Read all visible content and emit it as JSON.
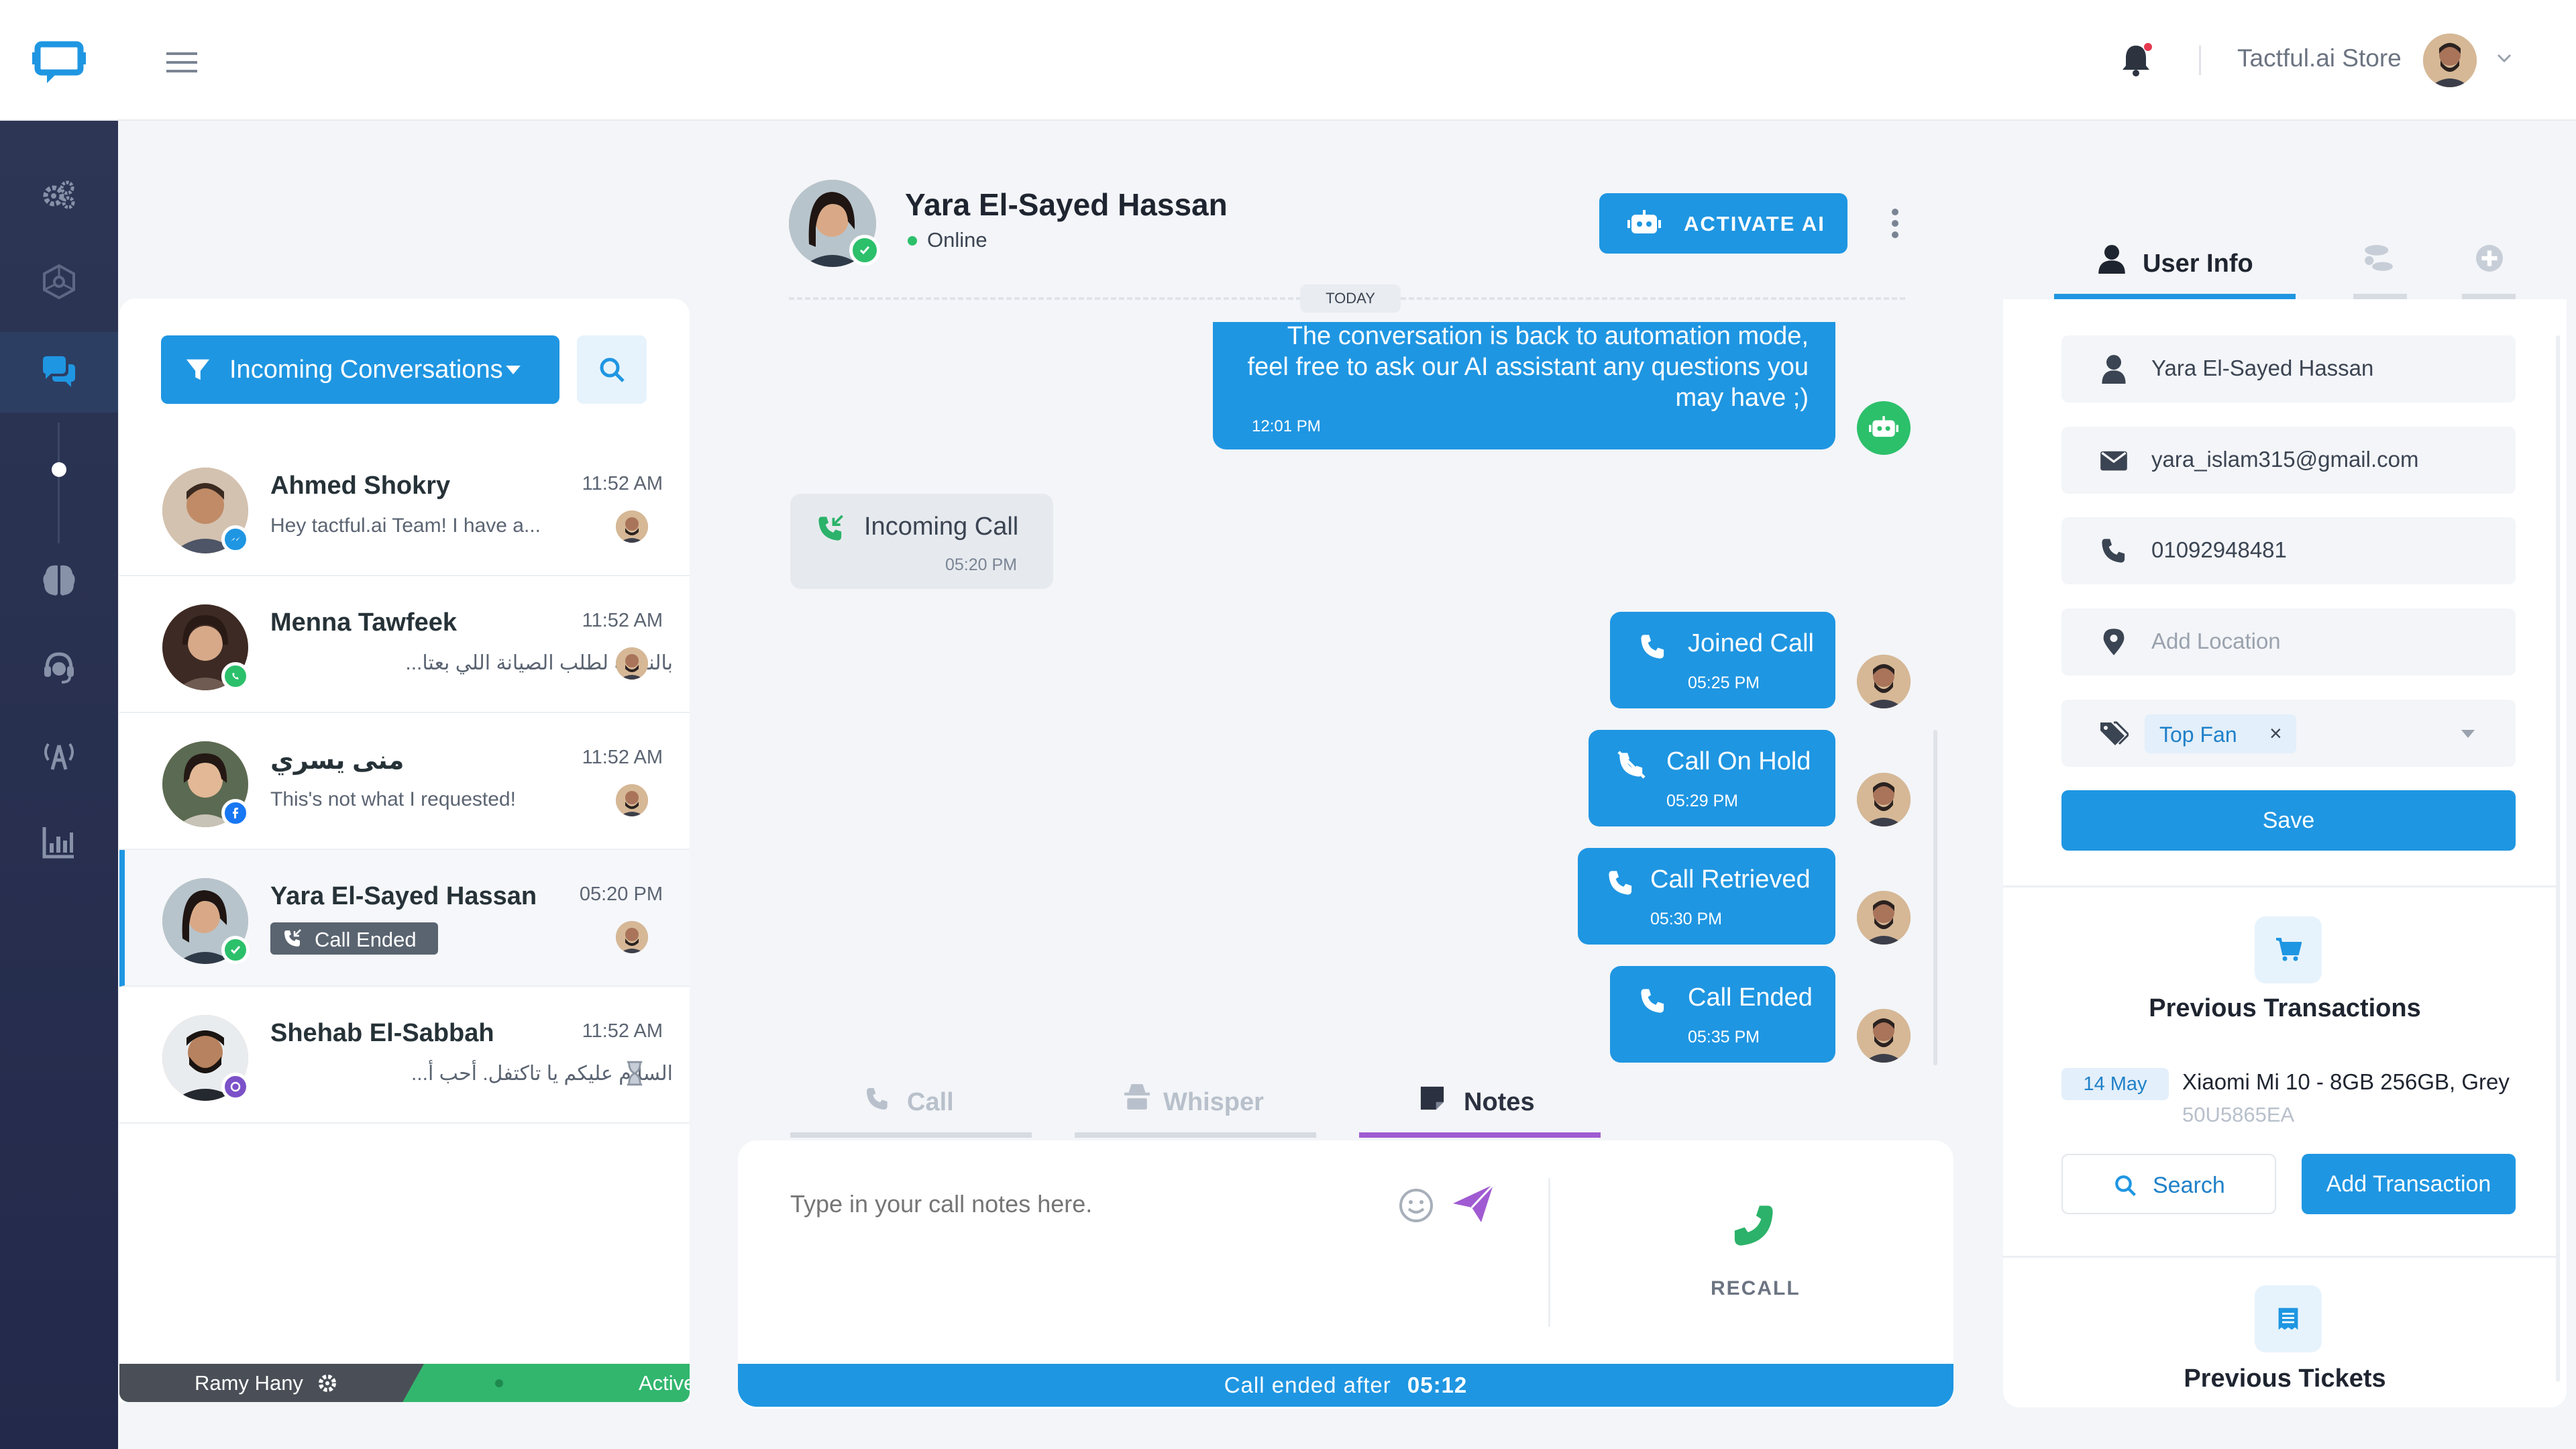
{
  "header": {
    "store_name": "Tactful.ai Store",
    "brand_color": "#1f96e2"
  },
  "sidebar": {
    "items": [
      "settings-icon",
      "network-icon",
      "chat-icon",
      "dot-icon",
      "brain-icon",
      "agent-icon",
      "broadcast-icon",
      "reports-icon"
    ]
  },
  "inbox": {
    "filter_label": "Incoming Conversations",
    "conversations": [
      {
        "name": "Ahmed Shokry",
        "time": "11:52 AM",
        "preview": "Hey tactful.ai Team! I have a...",
        "channel": "messenger"
      },
      {
        "name": "Menna Tawfeek",
        "time": "11:52 AM",
        "preview": "بالنسبة لطلب الصيانة اللي بعتا...",
        "channel": "whatsapp"
      },
      {
        "name": "منى يسري",
        "time": "11:52 AM",
        "preview": "This's not what I requested!",
        "channel": "facebook"
      },
      {
        "name": "Yara El-Sayed Hassan",
        "time": "05:20 PM",
        "preview": "Call Ended",
        "channel": "phone"
      },
      {
        "name": "Shehab El-Sabbah",
        "time": "11:52 AM",
        "preview": "السلام عليكم يا تاكتفل. أحب أ...",
        "channel": "viber"
      }
    ],
    "agent_name": "Ramy Hany",
    "agent_status": "Active"
  },
  "chat": {
    "contact_name": "Yara El-Sayed Hassan",
    "contact_status": "Online",
    "activate_ai_label": "ACTIVATE AI",
    "date_divider": "TODAY",
    "bot_message": {
      "line1": "The conversation is back to automation mode,",
      "line2": "feel free to ask our AI assistant any questions you",
      "line3": "may have ;)",
      "time": "12:01 PM"
    },
    "incoming_call": {
      "label": "Incoming Call",
      "time": "05:20 PM"
    },
    "events": [
      {
        "label": "Joined Call",
        "time": "05:25 PM"
      },
      {
        "label": "Call On Hold",
        "time": "05:29 PM"
      },
      {
        "label": "Call Retrieved",
        "time": "05:30 PM"
      },
      {
        "label": "Call Ended",
        "time": "05:35 PM"
      }
    ],
    "tabs": [
      {
        "label": "Call",
        "active": false
      },
      {
        "label": "Whisper",
        "active": false
      },
      {
        "label": "Notes",
        "active": true
      }
    ],
    "notes_placeholder": "Type in your call notes here.",
    "recall_label": "RECALL",
    "footer_text": "Call ended after",
    "footer_duration": "05:12"
  },
  "user_panel": {
    "tab_label": "User Info",
    "name": "Yara El-Sayed Hassan",
    "email": "yara_islam315@gmail.com",
    "phone": "01092948481",
    "location_placeholder": "Add Location",
    "tag": "Top Fan",
    "tag_remove": "×",
    "save_label": "Save",
    "transactions_title": "Previous Transactions",
    "transaction": {
      "date": "14 May",
      "item": "Xiaomi Mi 10 - 8GB 256GB, Grey",
      "code": "50U5865EA"
    },
    "search_label": "Search",
    "add_transaction_label": "Add Transaction",
    "tickets_title": "Previous Tickets"
  }
}
